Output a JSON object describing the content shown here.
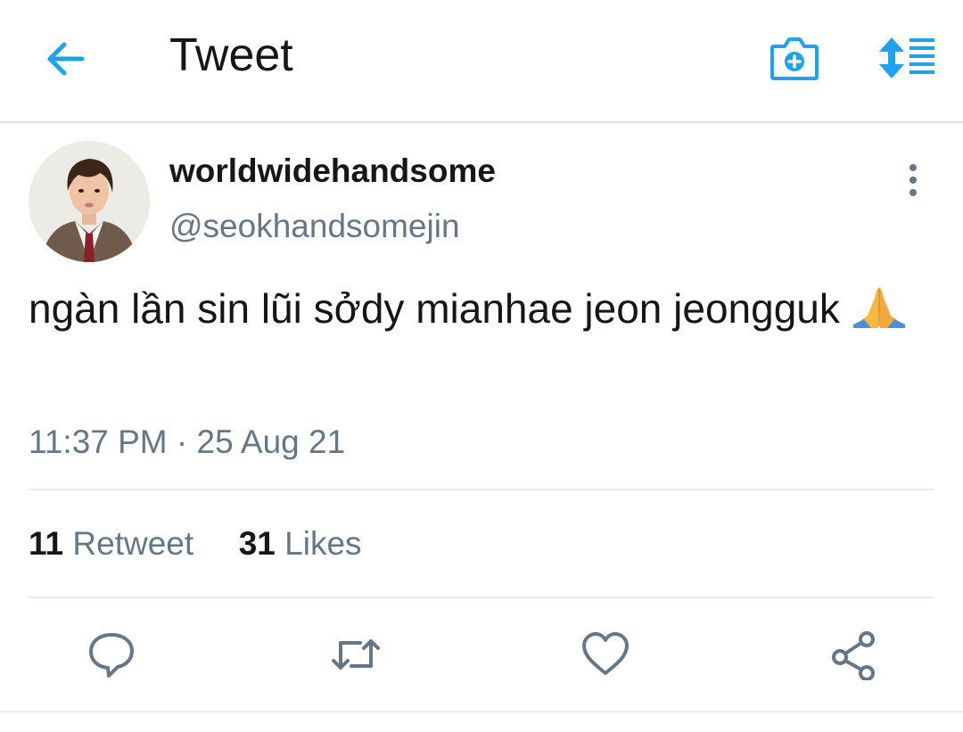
{
  "header": {
    "title": "Tweet",
    "back_icon": "arrow-left-icon",
    "camera_icon": "camera-plus-icon",
    "sort_icon": "sort-list-icon",
    "accent_color": "#1da1f2"
  },
  "tweet": {
    "display_name": "worldwidehandsome",
    "handle": "@seokhandsomejin",
    "text": "ngàn lần sin lũi sởdy mianhae jeon jeongguk",
    "emoji": "🙏",
    "timestamp": "11:37 PM · 25 Aug 21",
    "more_icon": "more-vertical-icon"
  },
  "stats": {
    "retweets_count": "11",
    "retweets_label": "Retweet",
    "likes_count": "31",
    "likes_label": "Likes"
  },
  "actions": [
    "reply-icon",
    "retweet-icon",
    "like-icon",
    "share-icon"
  ],
  "colors": {
    "text_primary": "#14171a",
    "text_secondary": "#657786",
    "icon_gray": "#657786",
    "divider": "#e6ecf0"
  }
}
